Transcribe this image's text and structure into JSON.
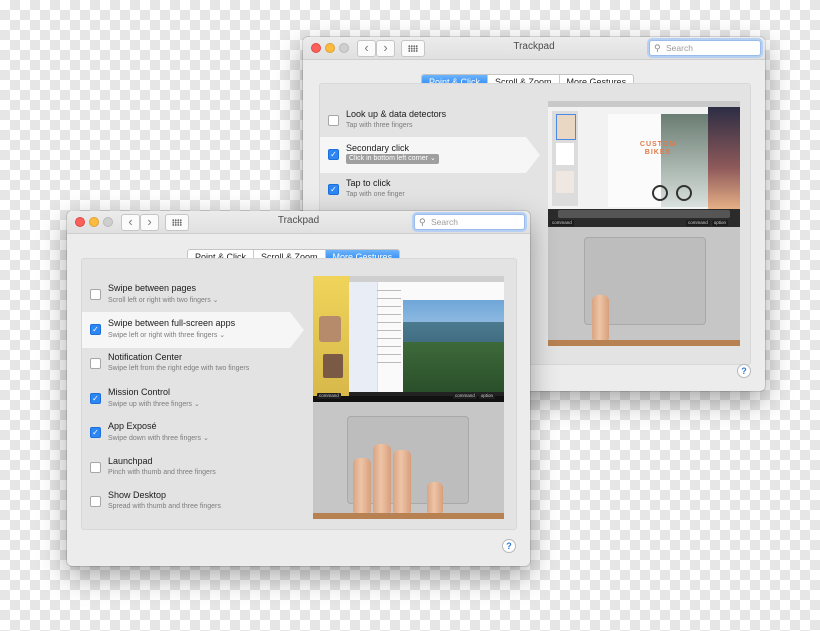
{
  "back_window": {
    "title": "Trackpad",
    "search_placeholder": "Search",
    "nav_back": "‹",
    "nav_forward": "›",
    "tabs": [
      "Point & Click",
      "Scroll & Zoom",
      "More Gestures"
    ],
    "active_tab": "Point & Click",
    "items": [
      {
        "title": "Look up & data detectors",
        "sub": "Tap with three fingers",
        "checked": false
      },
      {
        "title": "Secondary click",
        "sub": "Click in bottom left corner",
        "checked": true,
        "selected": true,
        "popup": true
      },
      {
        "title": "Tap to click",
        "sub": "Tap with one finger",
        "checked": true
      }
    ],
    "preview": {
      "poster_text": "CUSTOM BIKES",
      "keys_left": [
        "command"
      ],
      "keys_right": [
        "command",
        "option"
      ]
    },
    "help": "?"
  },
  "front_window": {
    "title": "Trackpad",
    "search_placeholder": "Search",
    "nav_back": "‹",
    "nav_forward": "›",
    "tabs": [
      "Point & Click",
      "Scroll & Zoom",
      "More Gestures"
    ],
    "active_tab": "More Gestures",
    "items": [
      {
        "title": "Swipe between pages",
        "sub": "Scroll left or right with two fingers",
        "checked": false,
        "chevron": true
      },
      {
        "title": "Swipe between full-screen apps",
        "sub": "Swipe left or right with three fingers",
        "checked": true,
        "chevron": true,
        "selected": true
      },
      {
        "title": "Notification Center",
        "sub": "Swipe left from the right edge with two fingers",
        "checked": false,
        "chevron": false
      },
      {
        "title": "Mission Control",
        "sub": "Swipe up with three fingers",
        "checked": true,
        "chevron": true
      },
      {
        "title": "App Exposé",
        "sub": "Swipe down with three fingers",
        "checked": true,
        "chevron": true
      },
      {
        "title": "Launchpad",
        "sub": "Pinch with thumb and three fingers",
        "checked": false,
        "chevron": false
      },
      {
        "title": "Show Desktop",
        "sub": "Spread with thumb and three fingers",
        "checked": false,
        "chevron": false
      }
    ],
    "preview": {
      "keys_left": [
        "command"
      ],
      "keys_right": [
        "command",
        "option"
      ]
    },
    "help": "?"
  },
  "icons": {
    "check": "✓",
    "chevron": "⌄",
    "search": "⚲"
  },
  "colors": {
    "accent": "#1e7ef5",
    "checkbox_on": "#2e86f3",
    "close": "#fc605b",
    "minimize": "#fdbc40"
  }
}
